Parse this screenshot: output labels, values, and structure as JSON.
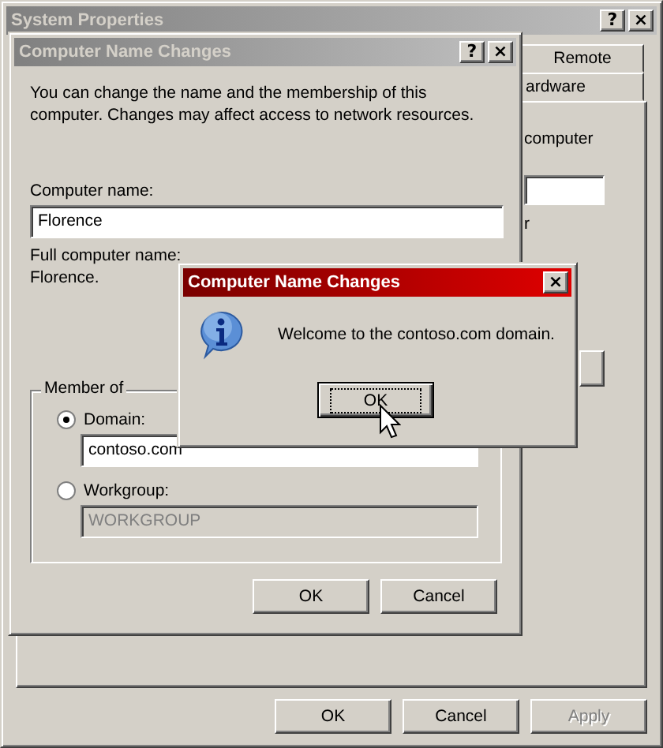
{
  "system_properties": {
    "title": "System Properties",
    "active": false,
    "title_buttons": [
      "?",
      "×"
    ],
    "tabs": [
      {
        "label": "Remote",
        "selected": false
      },
      {
        "label": "ardware",
        "selected": false
      }
    ],
    "panel_texts": [
      "computer",
      "r"
    ],
    "buttons": [
      {
        "label": "OK",
        "disabled": false
      },
      {
        "label": "Cancel",
        "disabled": false
      },
      {
        "label": "Apply",
        "disabled": true
      }
    ]
  },
  "name_dialog": {
    "title": "Computer Name Changes",
    "active": false,
    "title_buttons": [
      "?",
      "×"
    ],
    "intro": "You can change the name and the membership of this computer. Changes may affect access to network resources.",
    "name_label": "Computer name:",
    "name_value": "Florence",
    "full_label": "Full computer name:",
    "full_value": "Florence.",
    "group_label": "Member of",
    "options": [
      {
        "label": "Domain:",
        "selected": true,
        "value": "contoso.com",
        "disabled": false
      },
      {
        "label": "Workgroup:",
        "selected": false,
        "value": "WORKGROUP",
        "disabled": true
      }
    ],
    "buttons": [
      "OK",
      "Cancel"
    ]
  },
  "message_box": {
    "title": "Computer Name Changes",
    "active": true,
    "close": "×",
    "message": "Welcome to the contoso.com domain.",
    "button": "OK"
  }
}
